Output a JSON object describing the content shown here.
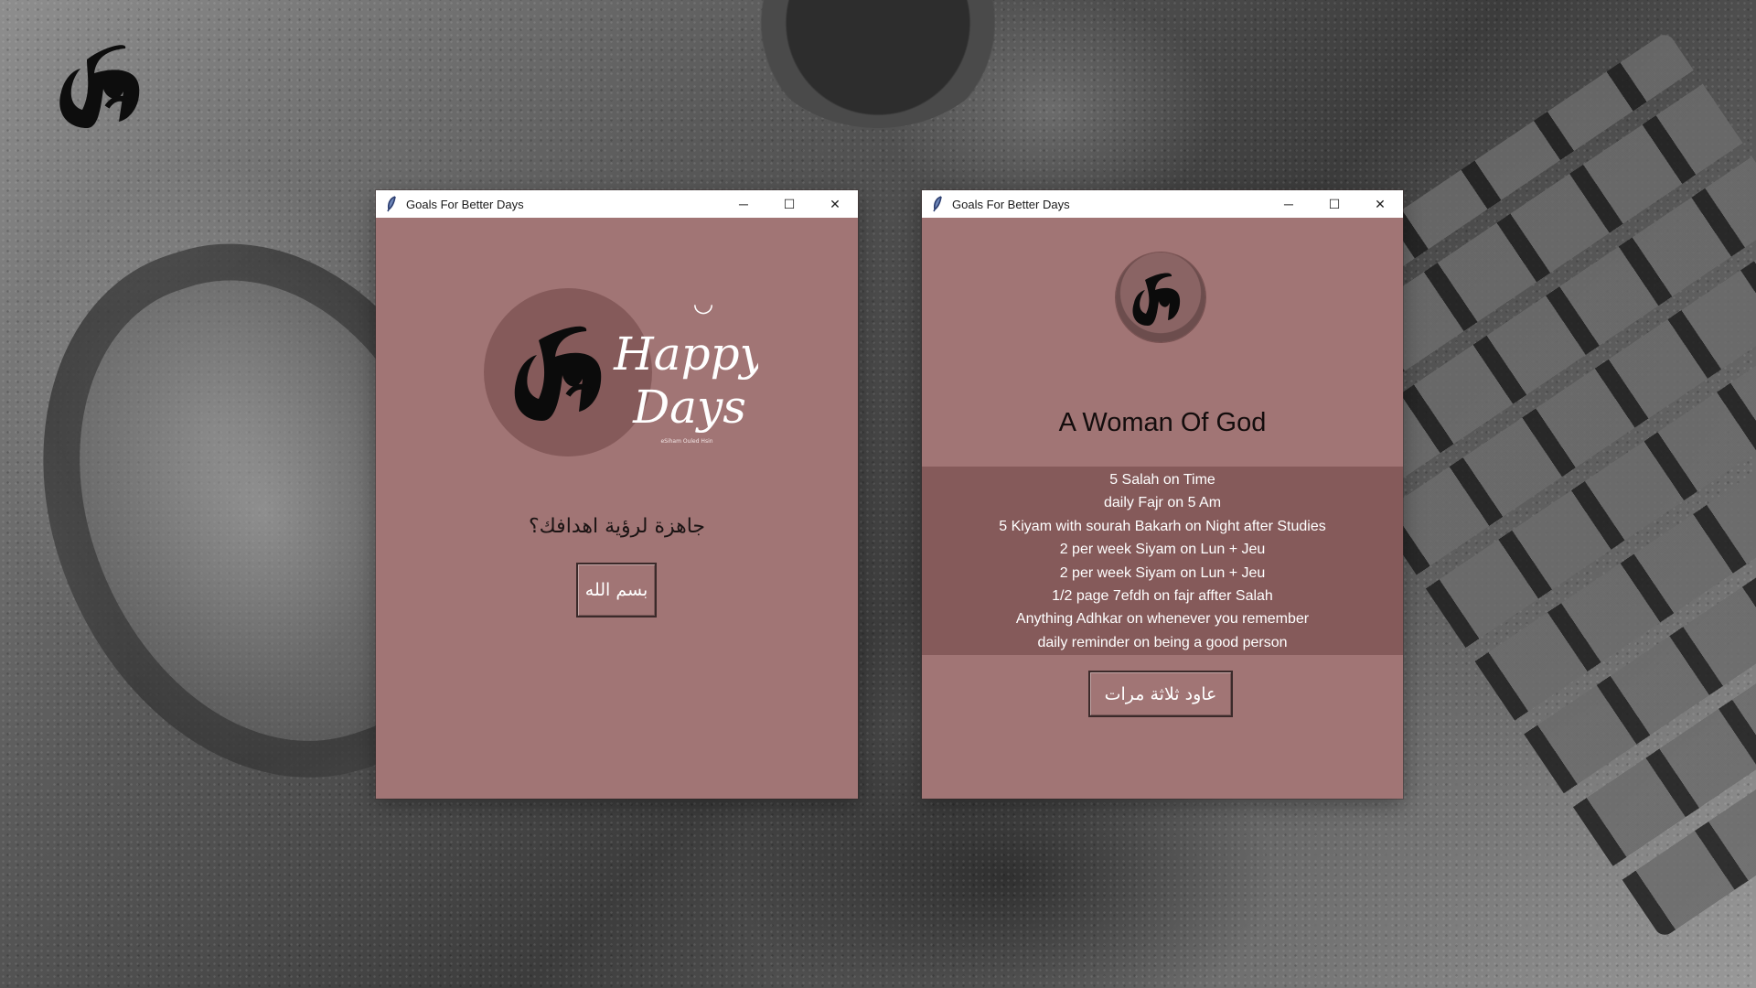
{
  "desktop": {
    "logo_icon": "arabic-calligraphy-logo-icon"
  },
  "window_left": {
    "title": "Goals For Better Days",
    "icon": "feather-icon",
    "controls": {
      "minimize": "─",
      "maximize": "☐",
      "close": "✕"
    },
    "logo": {
      "line1": "Happy",
      "line2": "Days",
      "signature": "eSiham Ouled Hsin",
      "smiley": "◡"
    },
    "question": "جاهزة لرؤية اهدافك؟",
    "start_button": "بسم الله"
  },
  "window_right": {
    "title": "Goals For Better Days",
    "icon": "feather-icon",
    "controls": {
      "minimize": "─",
      "maximize": "☐",
      "close": "✕"
    },
    "heading": "A Woman Of God",
    "goals": [
      "5 Salah on Time",
      "daily Fajr on 5 Am",
      "5 Kiyam with sourah Bakarh on Night after Studies",
      "2 per week Siyam on Lun + Jeu",
      "2 per week Siyam on Lun + Jeu",
      "1/2 page 7efdh on fajr affter Salah",
      "Anything Adhkar on whenever you remember",
      "daily reminder on being a good person"
    ],
    "repeat_button": "عاود ثلاثة مرات"
  },
  "colors": {
    "window_bg": "#a17575",
    "panel_bg": "#855a5a",
    "logo_circle": "#855a5a",
    "titlebar_bg": "#ffffff"
  }
}
